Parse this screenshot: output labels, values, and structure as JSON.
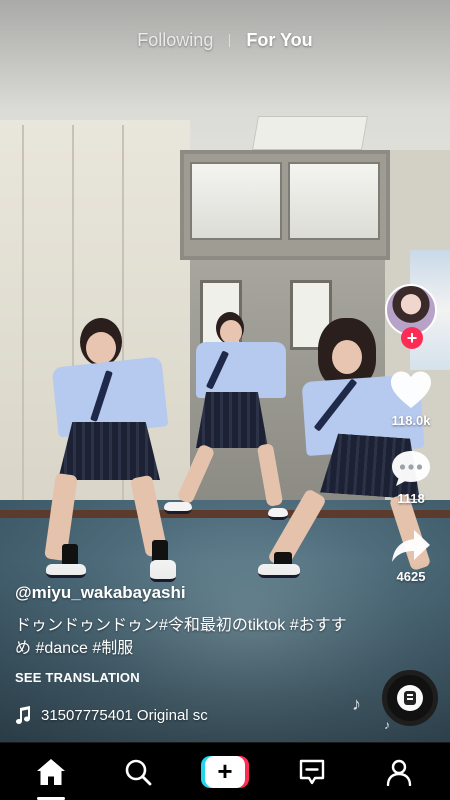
{
  "feed_tabs": {
    "following": "Following",
    "for_you": "For You",
    "active": "For You"
  },
  "creator": {
    "username": "@miyu_wakabayashi",
    "follow_icon": "plus-icon"
  },
  "post": {
    "caption": "ドゥンドゥンドゥン#令和最初のtiktok #おすすめ #dance #制服",
    "see_translation": "SEE TRANSLATION",
    "sound": "31507775401   Original sc"
  },
  "actions": {
    "likes": "118.0k",
    "comments": "1118",
    "shares": "4625"
  },
  "bottom_nav": {
    "items": [
      {
        "name": "home",
        "icon": "home-icon",
        "active": true
      },
      {
        "name": "discover",
        "icon": "search-icon"
      },
      {
        "name": "create",
        "icon": "plus-icon"
      },
      {
        "name": "inbox",
        "icon": "message-icon"
      },
      {
        "name": "profile",
        "icon": "person-icon"
      }
    ]
  },
  "colors": {
    "accent_red": "#fe2c55",
    "accent_cyan": "#20d5ec",
    "nav_bg": "#000000"
  }
}
